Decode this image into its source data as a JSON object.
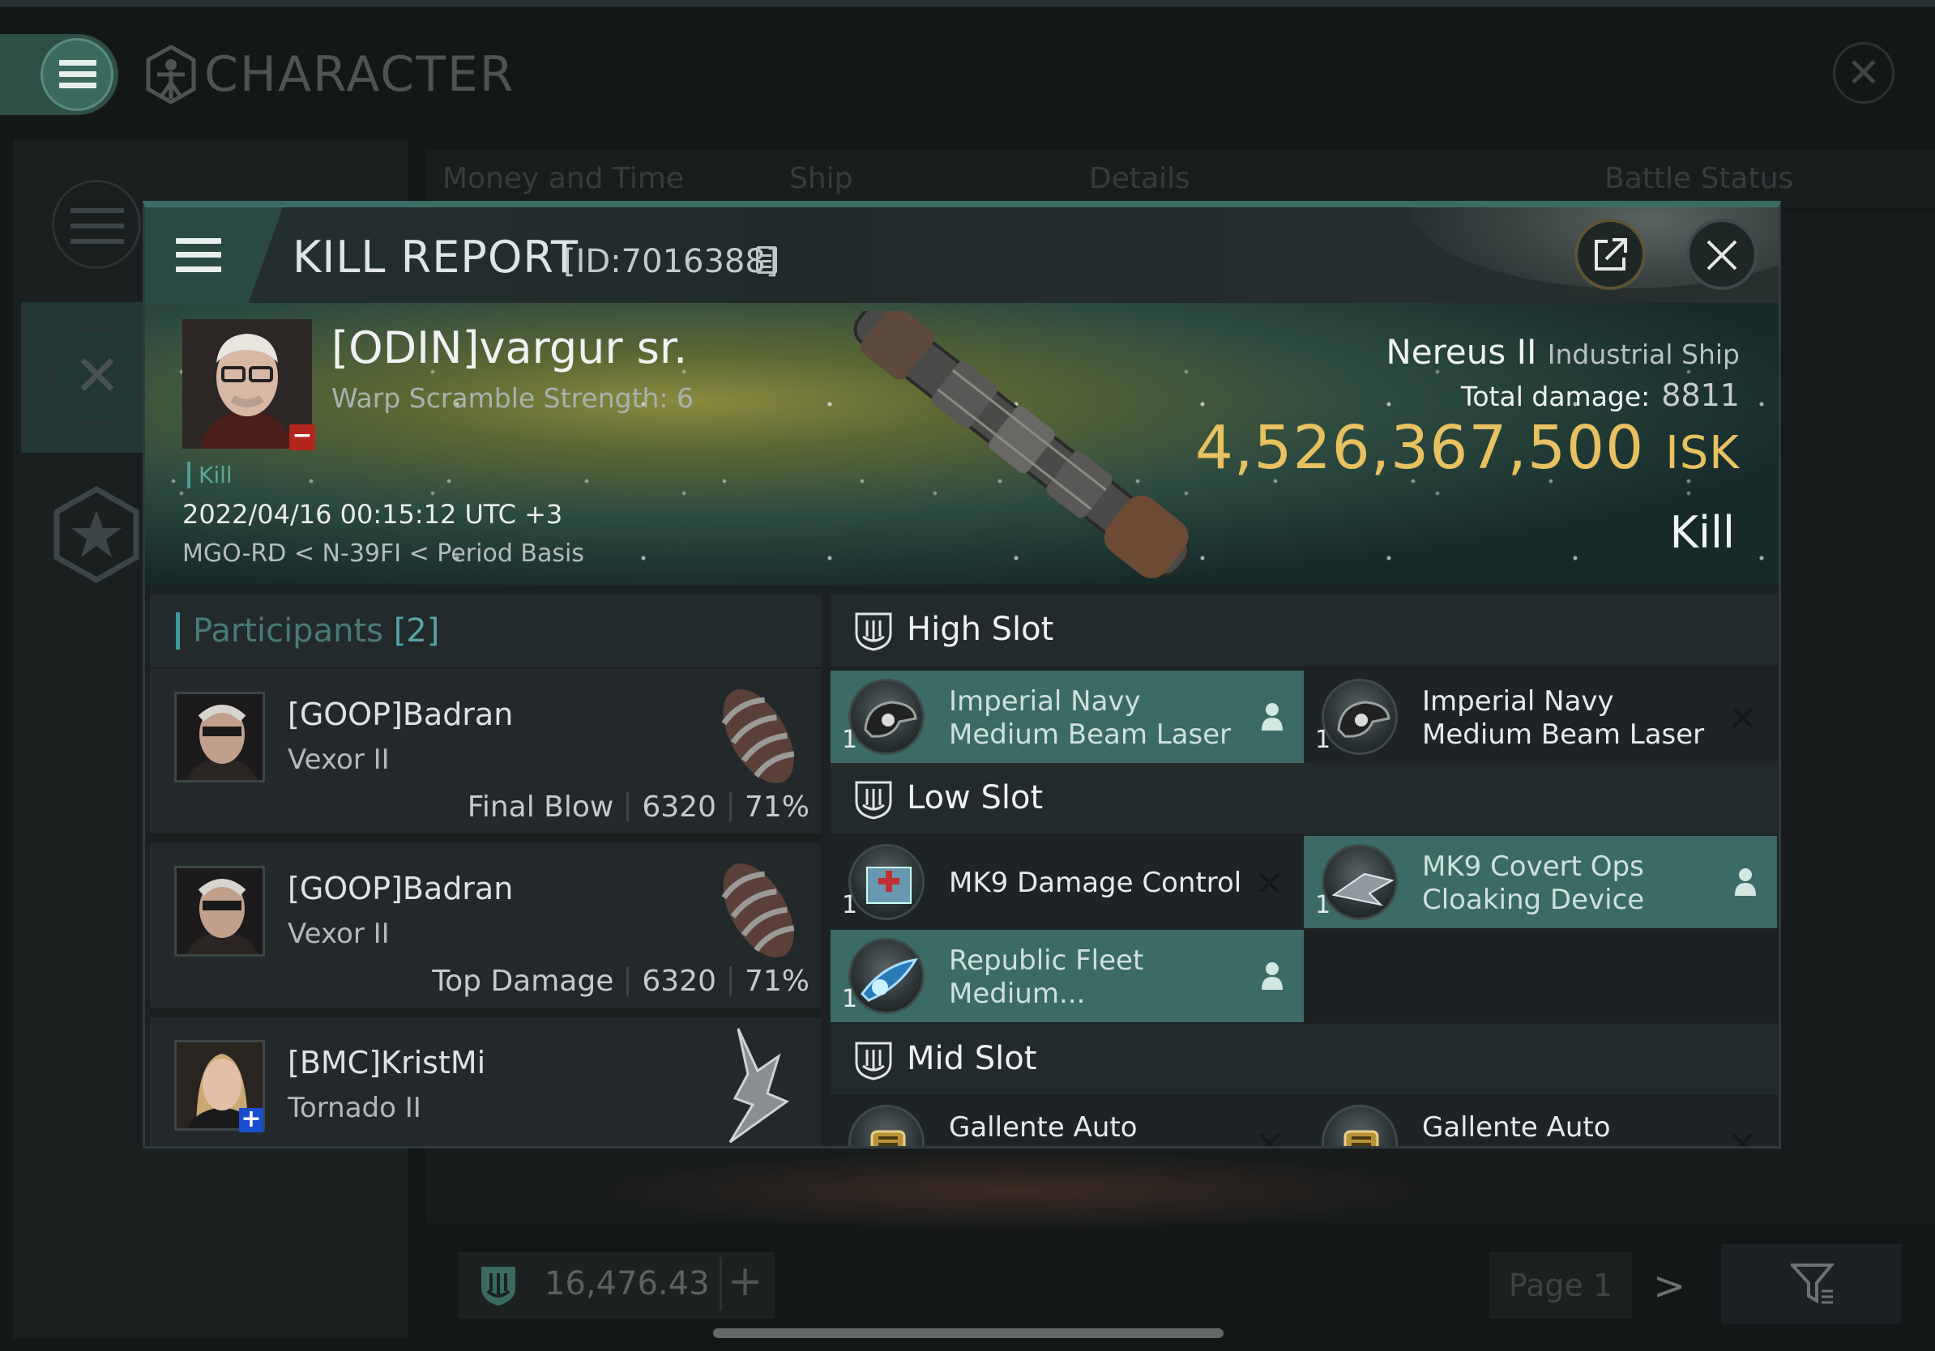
{
  "background": {
    "title": "CHARACTER",
    "tabs": [
      "Money and Time",
      "Ship",
      "Details",
      "Battle Status"
    ],
    "bottom_value": "16,476.43",
    "page_label": "Page 1"
  },
  "kill_report": {
    "title": "KILL REPORT",
    "id_label": "[ID:7016388]",
    "victim": {
      "name": "[ODIN]vargur sr.",
      "subtitle": "Warp Scramble Strength: 6",
      "kill_tag": "Kill",
      "date": "2022/04/16 00:15:12 UTC +3",
      "location": "MGO-RD < N-39FI < Period Basis"
    },
    "ship": {
      "name": "Nereus II",
      "class": "Industrial Ship",
      "total_damage_label": "Total damage:",
      "total_damage": "8811",
      "isk_value": "4,526,367,500",
      "isk_unit": "ISK",
      "result": "Kill"
    },
    "participants": {
      "label": "Participants",
      "count": "[2]",
      "rows": [
        {
          "name": "[GOOP]Badran",
          "ship": "Vexor II",
          "role": "Final Blow",
          "damage": "6320",
          "percent": "71%"
        },
        {
          "name": "[GOOP]Badran",
          "ship": "Vexor II",
          "role": "Top Damage",
          "damage": "6320",
          "percent": "71%"
        },
        {
          "name": "[BMC]KristMi",
          "ship": "Tornado II"
        }
      ]
    },
    "slots": {
      "high": {
        "label": "High Slot",
        "modules": [
          {
            "qty": "1",
            "name_line1": "Imperial Navy",
            "name_line2": "Medium Beam Laser",
            "status": "dropped"
          },
          {
            "qty": "1",
            "name_line1": "Imperial Navy",
            "name_line2": "Medium Beam Laser",
            "status": "destroyed"
          }
        ]
      },
      "low": {
        "label": "Low Slot",
        "modules": [
          {
            "qty": "1",
            "name_line1": "MK9 Damage Control",
            "name_line2": "",
            "status": "destroyed"
          },
          {
            "qty": "1",
            "name_line1": "MK9 Covert Ops",
            "name_line2": "Cloaking Device",
            "status": "dropped"
          },
          {
            "qty": "1",
            "name_line1": "Republic Fleet",
            "name_line2": "Medium...",
            "status": "dropped"
          }
        ]
      },
      "mid": {
        "label": "Mid Slot",
        "modules": [
          {
            "qty": "",
            "name_line1": "Gallente Auto",
            "name_line2": "",
            "status": "destroyed"
          },
          {
            "qty": "",
            "name_line1": "Gallente Auto",
            "name_line2": "",
            "status": "destroyed"
          }
        ]
      }
    }
  },
  "colors": {
    "accent_teal": "#3a6c64",
    "isk_gold": "#e8c160",
    "dropped_highlight": "#3c6a66",
    "victim_badge_red": "#b3261e",
    "ally_badge_blue": "#1a4ed0"
  }
}
